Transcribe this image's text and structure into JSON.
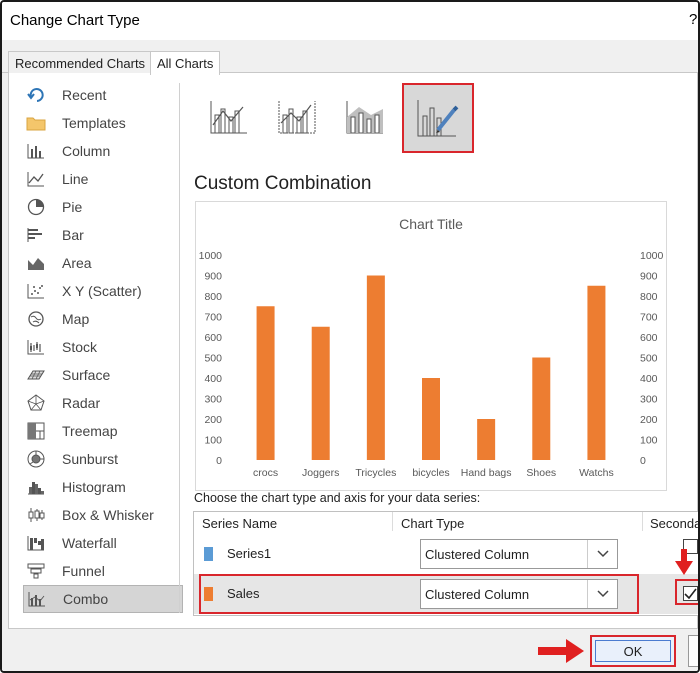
{
  "window": {
    "title": "Change Chart Type",
    "help_glyph": "?"
  },
  "tabs": [
    {
      "label": "Recommended Charts",
      "active": false
    },
    {
      "label": "All Charts",
      "active": true
    }
  ],
  "sidebar": {
    "items": [
      {
        "label": "Recent",
        "icon": "recent-icon"
      },
      {
        "label": "Templates",
        "icon": "templates-folder-icon"
      },
      {
        "label": "Column",
        "icon": "column-chart-icon"
      },
      {
        "label": "Line",
        "icon": "line-chart-icon"
      },
      {
        "label": "Pie",
        "icon": "pie-chart-icon"
      },
      {
        "label": "Bar",
        "icon": "bar-chart-icon"
      },
      {
        "label": "Area",
        "icon": "area-chart-icon"
      },
      {
        "label": "X Y (Scatter)",
        "icon": "scatter-chart-icon"
      },
      {
        "label": "Map",
        "icon": "map-chart-icon"
      },
      {
        "label": "Stock",
        "icon": "stock-chart-icon"
      },
      {
        "label": "Surface",
        "icon": "surface-chart-icon"
      },
      {
        "label": "Radar",
        "icon": "radar-chart-icon"
      },
      {
        "label": "Treemap",
        "icon": "treemap-chart-icon"
      },
      {
        "label": "Sunburst",
        "icon": "sunburst-chart-icon"
      },
      {
        "label": "Histogram",
        "icon": "histogram-chart-icon"
      },
      {
        "label": "Box & Whisker",
        "icon": "box-whisker-chart-icon"
      },
      {
        "label": "Waterfall",
        "icon": "waterfall-chart-icon"
      },
      {
        "label": "Funnel",
        "icon": "funnel-chart-icon"
      },
      {
        "label": "Combo",
        "icon": "combo-chart-icon",
        "active": true
      }
    ]
  },
  "combo_subtypes": [
    {
      "icon": "clustered-column-line-icon"
    },
    {
      "icon": "clustered-column-line-secondary-axis-icon"
    },
    {
      "icon": "stacked-area-clustered-column-icon"
    },
    {
      "icon": "custom-combination-icon",
      "selected": true
    }
  ],
  "section_title": "Custom Combination",
  "chart_data": {
    "type": "bar",
    "title": "Chart Title",
    "categories": [
      "crocs",
      "Joggers",
      "Tricycles",
      "bicycles",
      "Hand bags",
      "Shoes",
      "Watchs"
    ],
    "series": [
      {
        "name": "Sales",
        "values": [
          750,
          650,
          900,
          400,
          200,
          500,
          850
        ],
        "axis": "secondary",
        "color": "#ed7d31"
      }
    ],
    "ylim": [
      0,
      1000
    ],
    "yticks": [
      0,
      100,
      200,
      300,
      400,
      500,
      600,
      700,
      800,
      900,
      1000
    ],
    "secondary_ylim": [
      0,
      1000
    ],
    "secondary_yticks": [
      0,
      100,
      200,
      300,
      400,
      500,
      600,
      700,
      800,
      900,
      1000
    ],
    "grid": false
  },
  "series_grid": {
    "instruction": "Choose the chart type and axis for your data series:",
    "headers": {
      "series_name": "Series Name",
      "chart_type": "Chart Type",
      "secondary_axis": "Seconda"
    },
    "rows": [
      {
        "name": "Series1",
        "color": "#5b9bd5",
        "chart_type": "Clustered Column",
        "secondary_axis": false
      },
      {
        "name": "Sales",
        "color": "#ed7d31",
        "chart_type": "Clustered Column",
        "secondary_axis": true
      }
    ]
  },
  "footer": {
    "ok_label": "OK"
  },
  "colors": {
    "accent_red": "#d9262c",
    "bar_orange": "#ed7d31",
    "series1_blue": "#5b9bd5"
  }
}
